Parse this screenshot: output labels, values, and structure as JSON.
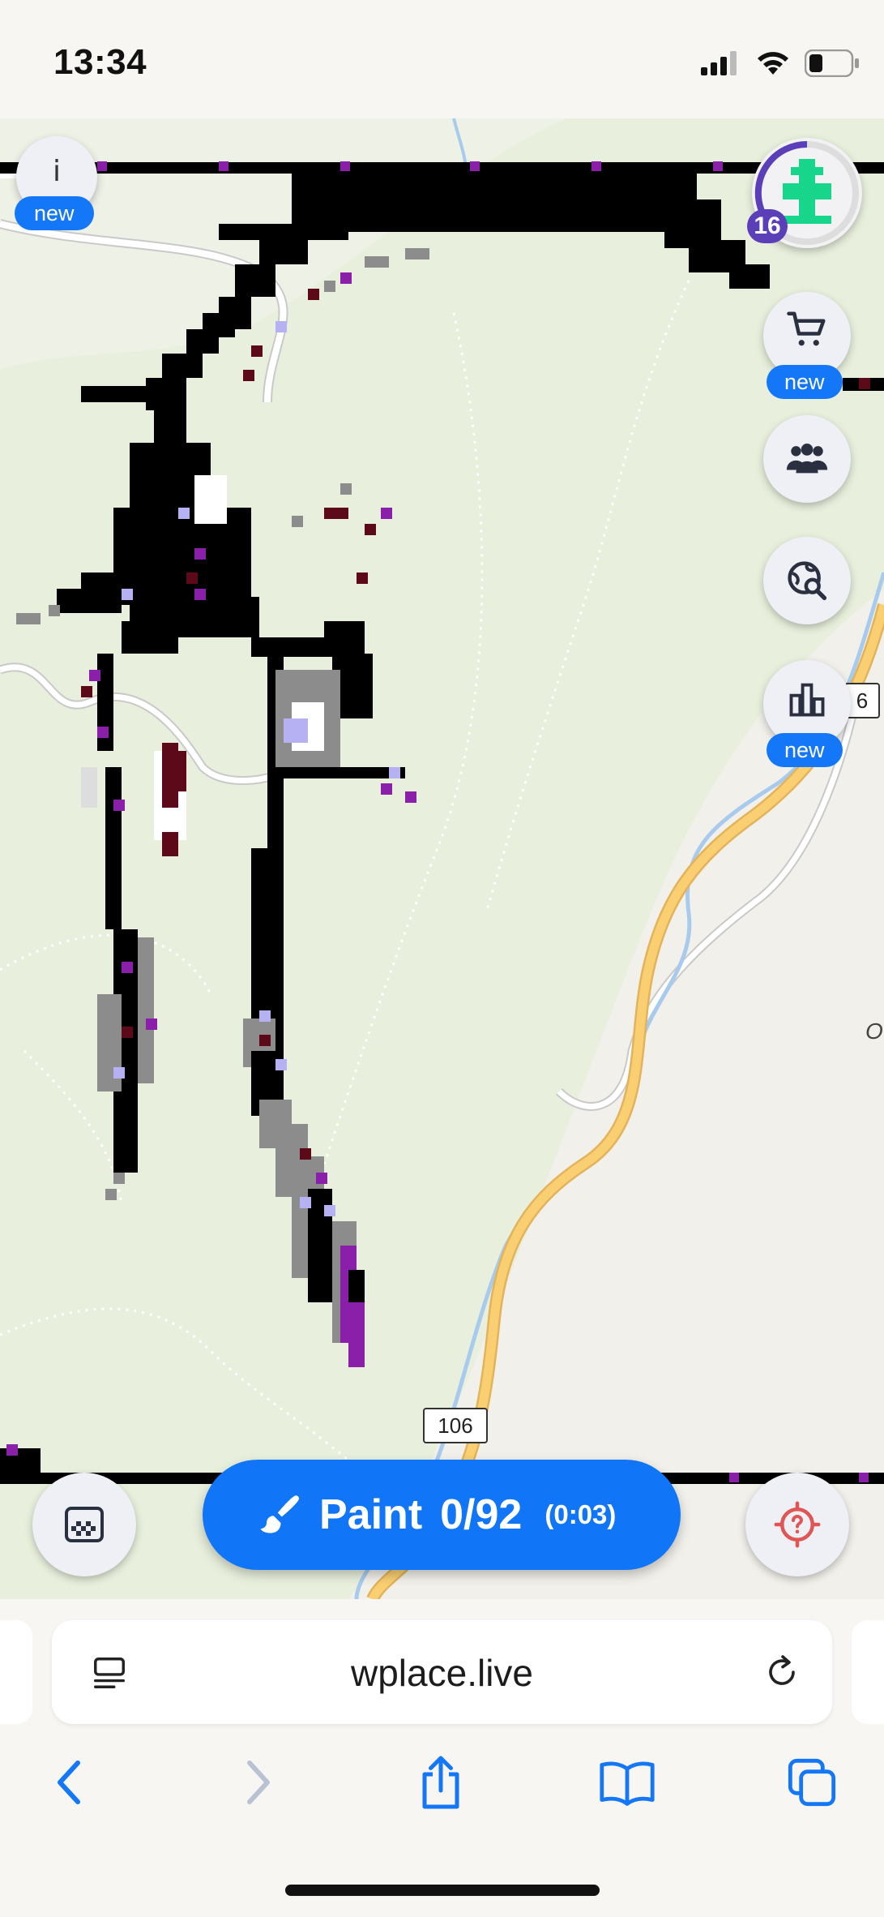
{
  "status_bar": {
    "time": "13:34"
  },
  "map": {
    "route_label": "106",
    "edge_label_right_1": "6",
    "edge_label_right_2": "O"
  },
  "toolbar": {
    "info_label": "i",
    "info_badge": "new",
    "level_badge": "16",
    "store_badge": "new",
    "leaderboard_badge": "new"
  },
  "paint_button": {
    "label": "Paint",
    "count": "0/92",
    "timer": "(0:03)"
  },
  "browser": {
    "url": "wplace.live"
  },
  "colors": {
    "accent": "#1175f7",
    "map_green": "#e8f0dd",
    "road_yellow": "#f9cf72",
    "river_blue": "#a8cbed"
  }
}
